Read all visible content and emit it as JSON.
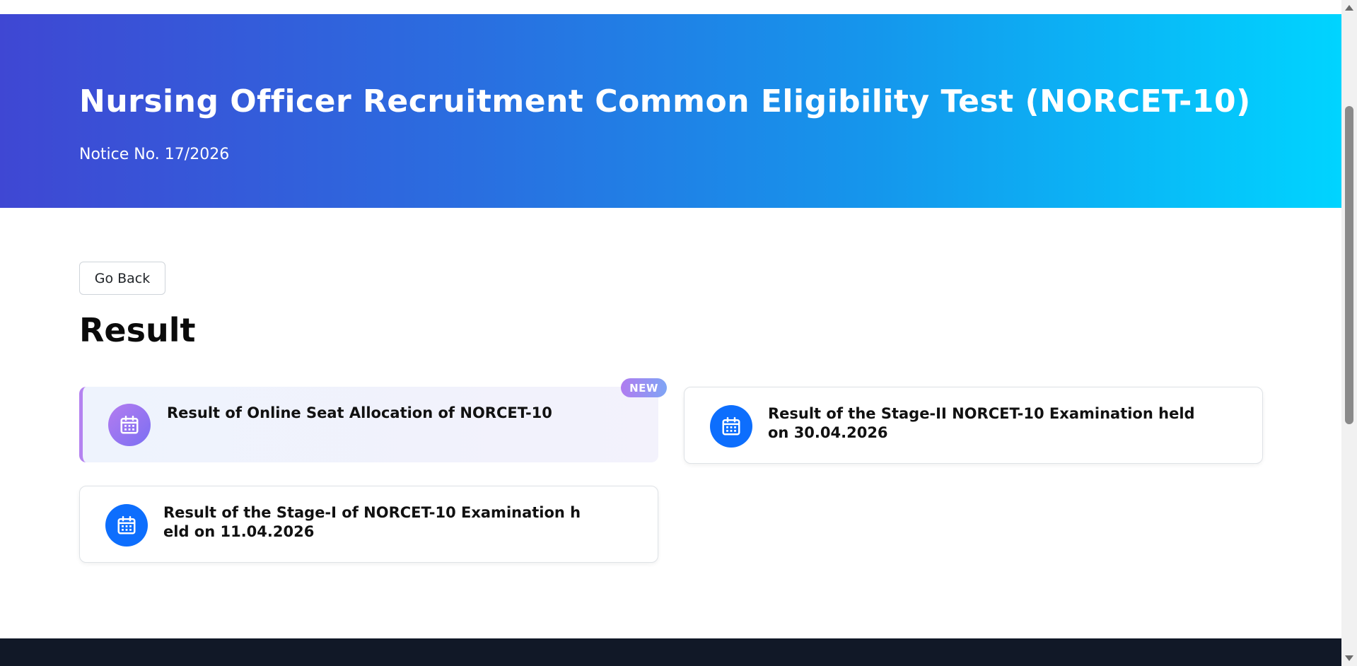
{
  "hero": {
    "title": "Nursing Officer Recruitment Common Eligibility Test (NORCET-10)",
    "subtitle": "Notice No. 17/2026",
    "gradient_start": "#3f47d3",
    "gradient_end": "#00d4ff"
  },
  "actions": {
    "back_label": "Go Back"
  },
  "section": {
    "title": "Result"
  },
  "cards": [
    {
      "text": "Result of Online Seat Allocation of NORCET-10",
      "icon": "calendar-icon",
      "badge": "NEW",
      "highlighted": true
    },
    {
      "text": "Result of the Stage-II NORCET-10 Examination held on 30.04.2026",
      "icon": "calendar-icon",
      "highlighted": false
    },
    {
      "text": "Result of the Stage-I of NORCET-10 Examination held on 11.04.2026",
      "icon": "calendar-icon",
      "highlighted": false
    }
  ],
  "colors": {
    "accent_blue": "#0d6efd",
    "badge_purple": "#b07cf0",
    "footer_dark": "#111827"
  }
}
